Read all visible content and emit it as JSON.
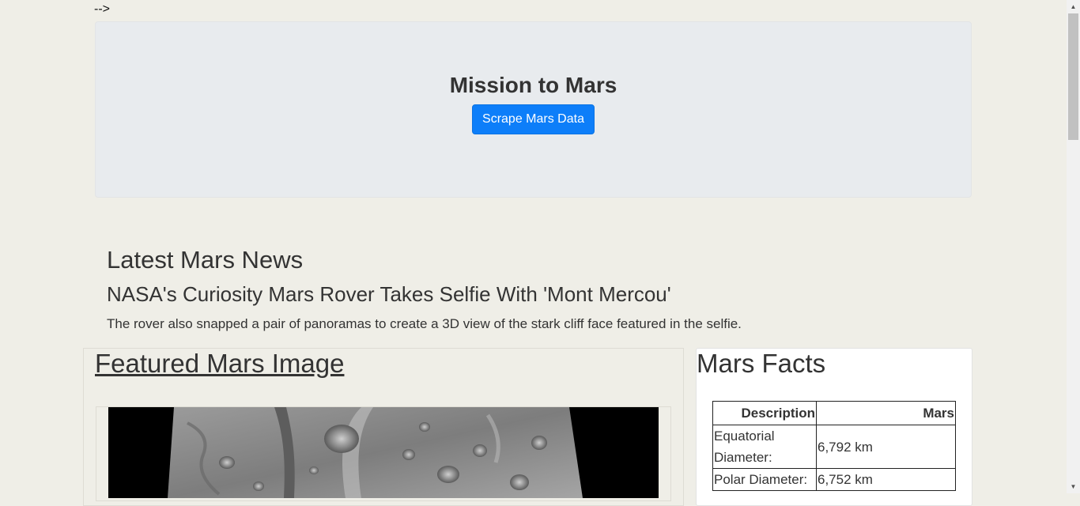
{
  "stray_text": "-->",
  "header": {
    "title": "Mission to Mars",
    "scrape_button": "Scrape Mars Data"
  },
  "news": {
    "section_title": "Latest Mars News",
    "headline": "NASA's Curiosity Mars Rover Takes Selfie With 'Mont Mercou'",
    "teaser": "The rover also snapped a pair of panoramas to create a 3D view of the stark cliff face featured in the selfie."
  },
  "featured": {
    "title": "Featured Mars Image"
  },
  "facts": {
    "title": "Mars Facts",
    "columns": [
      "Description",
      "Mars"
    ],
    "rows": [
      [
        "Equatorial Diameter:",
        "6,792 km"
      ],
      [
        "Polar Diameter:",
        "6,752 km"
      ]
    ]
  },
  "icons": {
    "scroll_up": "scroll-up-arrow-icon",
    "scroll_down": "scroll-down-arrow-icon"
  },
  "colors": {
    "page_bg": "#efeee7",
    "jumbotron_bg": "#e8ebee",
    "button_bg": "#0d7ef9"
  }
}
